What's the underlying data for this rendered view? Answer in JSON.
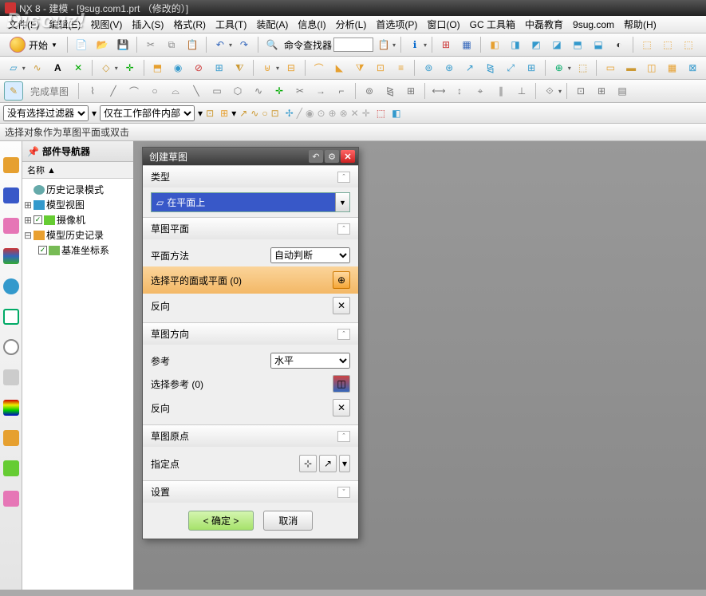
{
  "title": "NX 8 - 建模 - [9sug.com1.prt （修改的）]",
  "watermark": "Discuz!",
  "menu": [
    "文件(F)",
    "编辑(E)",
    "视图(V)",
    "插入(S)",
    "格式(R)",
    "工具(T)",
    "装配(A)",
    "信息(I)",
    "分析(L)",
    "首选项(P)",
    "窗口(O)",
    "GC 工具箱",
    "中磊教育",
    "9sug.com",
    "帮助(H)"
  ],
  "start_label": "开始",
  "cmd_finder_label": "命令查找器",
  "sketch_done": "完成草图",
  "filters": {
    "sel_filter": "没有选择过滤器",
    "scope": "仅在工作部件内部"
  },
  "status_msg": "选择对象作为草图平面或双击",
  "navigator": {
    "title": "部件导航器",
    "col": "名称 ▲",
    "items": [
      {
        "exp": "",
        "chk": "",
        "icon": "#6aa",
        "label": "历史记录模式"
      },
      {
        "exp": "+",
        "chk": "",
        "icon": "#39c",
        "label": "模型视图"
      },
      {
        "exp": "+",
        "chk": "✓",
        "icon": "#6c3",
        "label": "摄像机"
      },
      {
        "exp": "−",
        "chk": "",
        "icon": "#e9a030",
        "label": "模型历史记录"
      },
      {
        "exp": "",
        "chk": "✓",
        "icon": "#7b5",
        "label": "基准坐标系",
        "indent": 1
      }
    ]
  },
  "dialog": {
    "title": "创建草图",
    "sections": {
      "type": {
        "header": "类型",
        "value": "在平面上"
      },
      "plane": {
        "header": "草图平面",
        "method_label": "平面方法",
        "method_value": "自动判断",
        "select_label": "选择平的面或平面 (0)",
        "reverse": "反向"
      },
      "orient": {
        "header": "草图方向",
        "ref_label": "参考",
        "ref_value": "水平",
        "select_ref": "选择参考 (0)",
        "reverse": "反向"
      },
      "origin": {
        "header": "草图原点",
        "point_label": "指定点"
      },
      "settings": {
        "header": "设置"
      }
    },
    "ok": "< 确定 >",
    "cancel": "取消"
  }
}
